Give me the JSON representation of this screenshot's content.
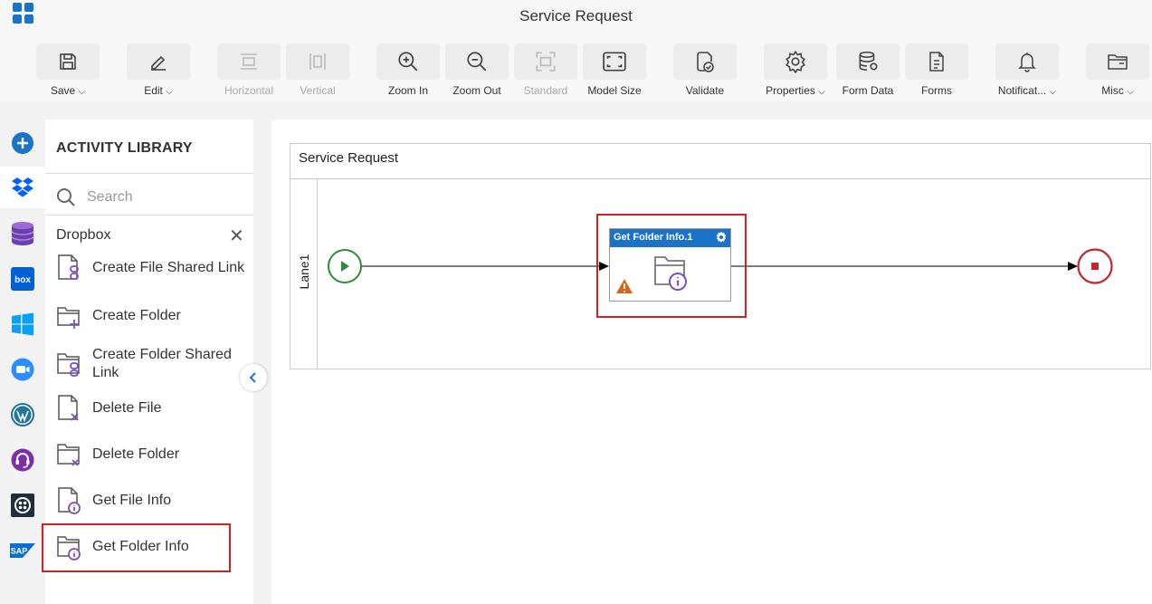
{
  "app": {
    "title": "Service Request"
  },
  "toolbar": {
    "save": "Save",
    "edit": "Edit",
    "horizontal": "Horizontal",
    "vertical": "Vertical",
    "zoom_in": "Zoom In",
    "zoom_out": "Zoom Out",
    "standard": "Standard",
    "model_size": "Model Size",
    "validate": "Validate",
    "properties": "Properties",
    "form_data": "Form Data",
    "forms": "Forms",
    "notifications": "Notificat...",
    "misc": "Misc"
  },
  "rail": {
    "items": [
      "add-icon",
      "dropbox-icon",
      "database-icon",
      "box-icon",
      "windows-icon",
      "zoom-icon",
      "wordpress-icon",
      "support-icon",
      "twilio-icon",
      "sap-icon"
    ]
  },
  "library": {
    "title": "ACTIVITY LIBRARY",
    "search_placeholder": "Search",
    "group": "Dropbox",
    "activities": [
      {
        "label": "Create File Shared Link"
      },
      {
        "label": "Create Folder"
      },
      {
        "label": "Create Folder Shared Link"
      },
      {
        "label": "Delete File"
      },
      {
        "label": "Delete Folder"
      },
      {
        "label": "Get File Info"
      },
      {
        "label": "Get Folder Info"
      }
    ]
  },
  "process": {
    "pool_title": "Service Request",
    "lane": "Lane1",
    "task_title": "Get Folder Info.1"
  },
  "colors": {
    "accent": "#1a73c9",
    "highlight": "#d32020",
    "start": "#2e8b3a",
    "end": "#c0282d",
    "activity_icon": "#7b4fc4",
    "warning": "#d9641e"
  }
}
